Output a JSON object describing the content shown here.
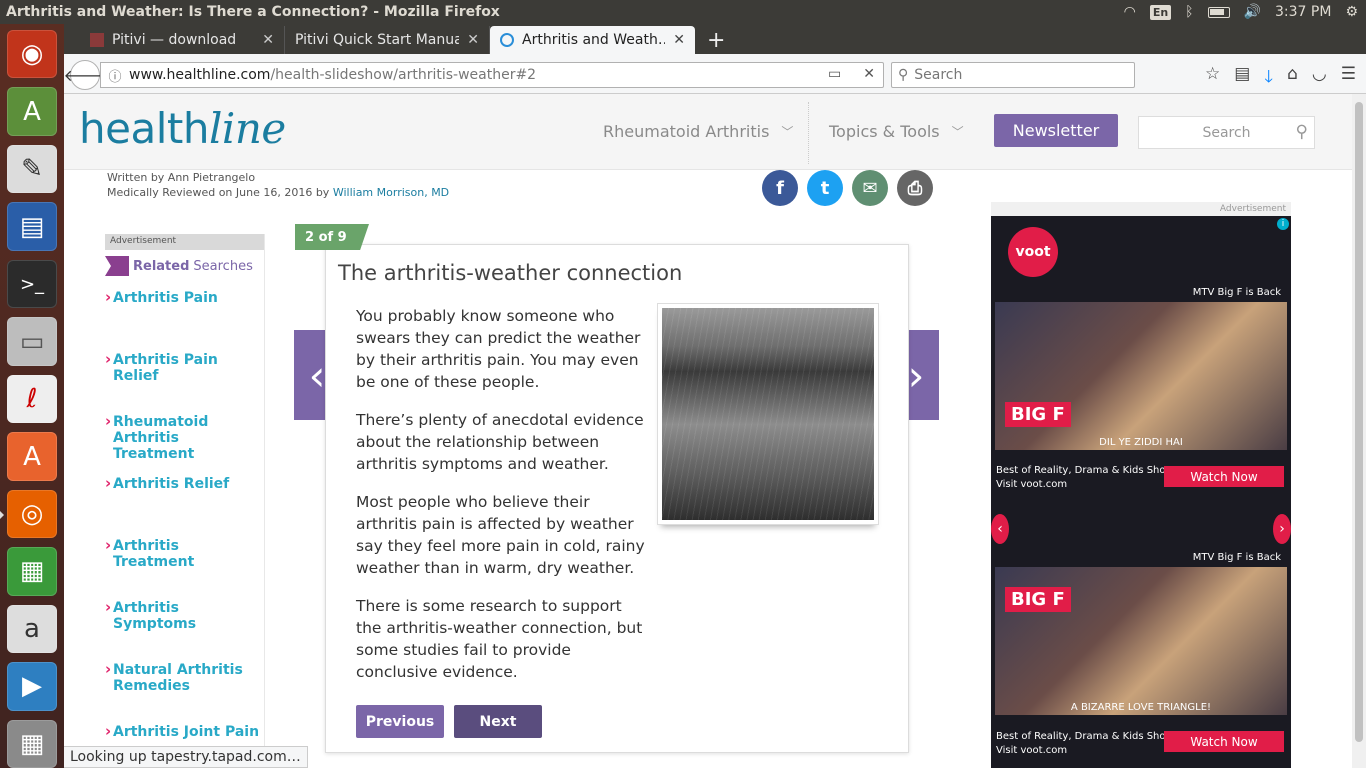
{
  "window": {
    "title": "Arthritis and Weather: Is There a Connection? - Mozilla Firefox"
  },
  "tray": {
    "lang": "En",
    "time": "3:37 PM"
  },
  "launcher": {
    "items": [
      "ubuntu-dash",
      "android-studio",
      "text-editor",
      "libreoffice-writer",
      "terminal",
      "files",
      "document-viewer",
      "software-center",
      "firefox",
      "libreoffice-calc",
      "amazon",
      "remmina",
      "workspaces"
    ]
  },
  "tabs": [
    {
      "label": "Pitivi — download",
      "active": false
    },
    {
      "label": "Pitivi Quick Start Manual",
      "active": false
    },
    {
      "label": "Arthritis and Weath…",
      "active": true
    }
  ],
  "nav": {
    "url_domain": "www.healthline.com",
    "url_path": "/health-slideshow/arthritis-weather#2",
    "search_placeholder": "Search"
  },
  "site": {
    "logo_health": "health",
    "logo_line": "line",
    "nav_items": [
      "Rheumatoid Arthritis",
      "Topics & Tools"
    ],
    "newsletter": "Newsletter",
    "search_placeholder": "Search"
  },
  "byline": {
    "written": "Written by Ann Pietrangelo",
    "reviewed_prefix": "Medically Reviewed on June 16, 2016 by",
    "reviewer": "William Morrison, MD"
  },
  "social": {
    "facebook": "f",
    "twitter": "t",
    "email": "✉",
    "print": "⎙"
  },
  "leftrail": {
    "ad_label": "Advertisement",
    "related_label_1": "Related",
    "related_label_2": "Searches",
    "links": [
      "Arthritis Pain",
      "Arthritis Pain Relief",
      "Rheumatoid Arthritis Treatment",
      "Arthritis Relief",
      "Arthritis Treatment",
      "Arthritis Symptoms",
      "Natural Arthritis Remedies",
      "Arthritis Joint Pain"
    ]
  },
  "slide": {
    "counter": "2 of 9",
    "title": "The arthritis-weather connection",
    "paragraphs": [
      "You probably know someone who swears they can predict the weather by their arthritis pain. You may even be one of these people.",
      "There’s plenty of anecdotal evidence about the relationship between arthritis symptoms and weather.",
      "Most people who believe their arthritis pain is affected by weather say they feel more pain in cold, rainy weather than in warm, dry weather.",
      "There is some research to support the arthritis-weather connection, but some studies fail to provide conclusive evidence."
    ],
    "previous": "Previous",
    "next": "Next"
  },
  "rightad": {
    "ad_label": "Advertisement",
    "brand": "voot",
    "panels": [
      {
        "label": "MTV Big F is Back",
        "caption": "DIL YE ZIDDI HAI",
        "logo": "BIG F",
        "promo_line1": "Best of Reality, Drama & Kids Shows",
        "promo_line2": "Visit voot.com",
        "cta": "Watch Now"
      },
      {
        "label": "MTV Big F is Back",
        "caption": "A BIZARRE LOVE TRIANGLE!",
        "logo": "BIG F",
        "promo_line1": "Best of Reality, Drama & Kids Shows",
        "promo_line2": "Visit voot.com",
        "cta": "Watch Now"
      }
    ]
  },
  "status": "Looking up tapestry.tapad.com…",
  "colors": {
    "brand_teal": "#1b7da0",
    "purple": "#7b66a8",
    "link_teal": "#29a9c7",
    "counter_green": "#6aa46a",
    "ad_red": "#e11d48"
  }
}
